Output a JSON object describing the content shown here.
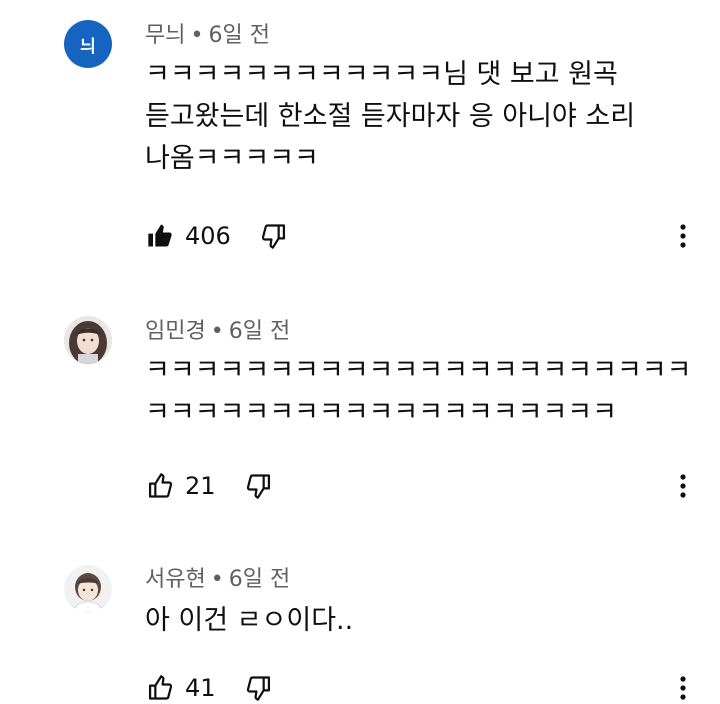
{
  "comments": [
    {
      "avatar_initial": "늬",
      "avatar_color": "#1565c0",
      "author": "무늬",
      "separator": "•",
      "time": "6일 전",
      "lines": [
        "ㅋㅋㅋㅋㅋㅋㅋㅋㅋㅋㅋㅋ님 댓 보고 원곡",
        "듣고왔는데 한소절 듣자마자 응 아니야 소리",
        "나옴ㅋㅋㅋㅋㅋ"
      ],
      "likes": "406",
      "liked": true
    },
    {
      "author": "임민경",
      "separator": "•",
      "time": "6일 전",
      "lines": [
        "ㅋㅋㅋㅋㅋㅋㅋㅋㅋㅋㅋㅋㅋㅋㅋㅋㅋㅋㅋㅋㅋㅋ",
        "ㅋㅋㅋㅋㅋㅋㅋㅋㅋㅋㅋㅋㅋㅋㅋㅋㅋㅋㅋ"
      ],
      "likes": "21",
      "liked": false
    },
    {
      "author": "서유현",
      "separator": "•",
      "time": "6일 전",
      "lines": [
        "아 이건 ㄹㅇ이다.."
      ],
      "likes": "41",
      "liked": false
    }
  ]
}
